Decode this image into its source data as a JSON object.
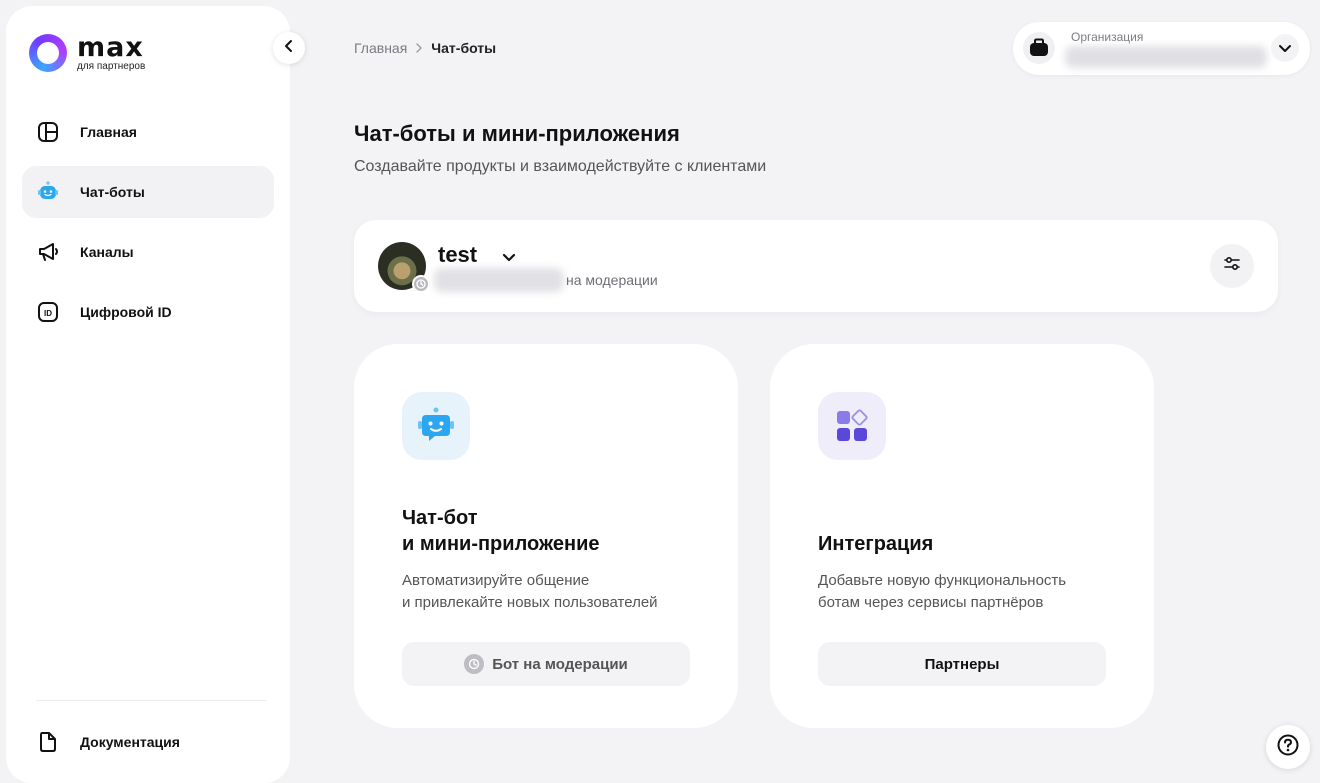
{
  "logo": {
    "title": "max",
    "subtitle": "для партнеров"
  },
  "sidebar": {
    "items": [
      {
        "label": "Главная",
        "icon": "home-dashboard-icon"
      },
      {
        "label": "Чат-боты",
        "icon": "robot-icon",
        "active": true
      },
      {
        "label": "Каналы",
        "icon": "megaphone-icon"
      },
      {
        "label": "Цифровой ID",
        "icon": "id-card-icon"
      }
    ],
    "docs_label": "Документация"
  },
  "breadcrumb": {
    "home": "Главная",
    "current": "Чат-боты"
  },
  "organization": {
    "label": "Организация"
  },
  "page": {
    "title": "Чат-боты и мини-приложения",
    "subtitle": "Создавайте продукты и взаимодействуйте с клиентами"
  },
  "bot": {
    "name": "test",
    "status": "на модерации"
  },
  "features": [
    {
      "title_line1": "Чат-бот",
      "title_line2": "и мини-приложение",
      "desc_line1": "Автоматизируйте общение",
      "desc_line2": "и привлекайте новых пользователей",
      "button": "Бот на модерации"
    },
    {
      "title_line1": "Интеграция",
      "desc_line1": "Добавьте новую функциональность",
      "desc_line2": "ботам через сервисы партнёров",
      "button": "Партнеры"
    }
  ],
  "colors": {
    "accent_blue": "#2aa7f0",
    "accent_purple": "#7a63e6",
    "background": "#f3f3f6"
  }
}
